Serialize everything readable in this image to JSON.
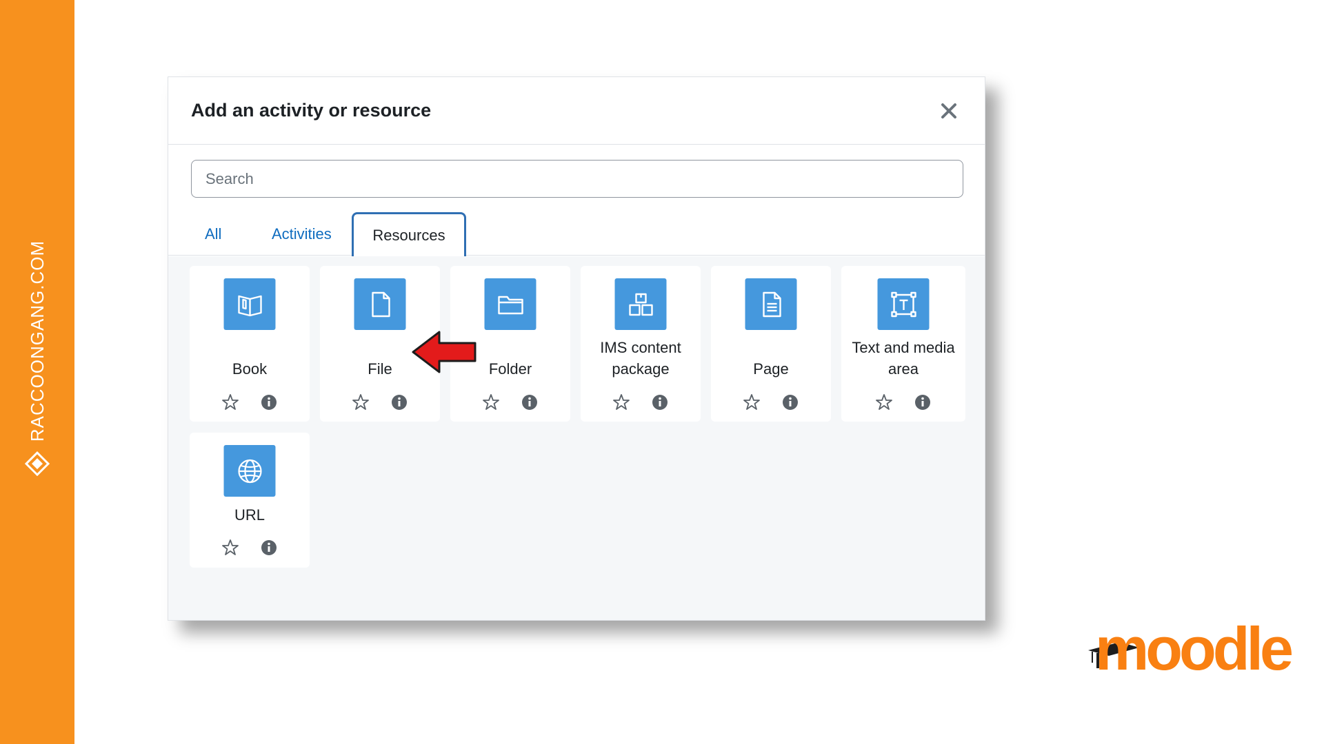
{
  "brand": {
    "site": "RACCOONGANG.COM",
    "accent": "#f7911e"
  },
  "modal": {
    "title": "Add an activity or resource",
    "close_icon": "close-icon",
    "search_placeholder": "Search",
    "tabs": [
      {
        "label": "All",
        "active": false
      },
      {
        "label": "Activities",
        "active": false
      },
      {
        "label": "Resources",
        "active": true
      }
    ],
    "tiles": [
      {
        "label": "Book",
        "icon": "book-icon"
      },
      {
        "label": "File",
        "icon": "file-icon"
      },
      {
        "label": "Folder",
        "icon": "folder-icon"
      },
      {
        "label": "IMS content package",
        "icon": "package-icon"
      },
      {
        "label": "Page",
        "icon": "page-icon"
      },
      {
        "label": "Text and media area",
        "icon": "text-media-icon"
      },
      {
        "label": "URL",
        "icon": "globe-icon"
      }
    ],
    "icon_color": "#4598dd"
  },
  "annotation": {
    "arrow_color": "#e31b1b",
    "points_to": "File"
  },
  "logo": {
    "text": "moodle",
    "color": "#f98012"
  }
}
